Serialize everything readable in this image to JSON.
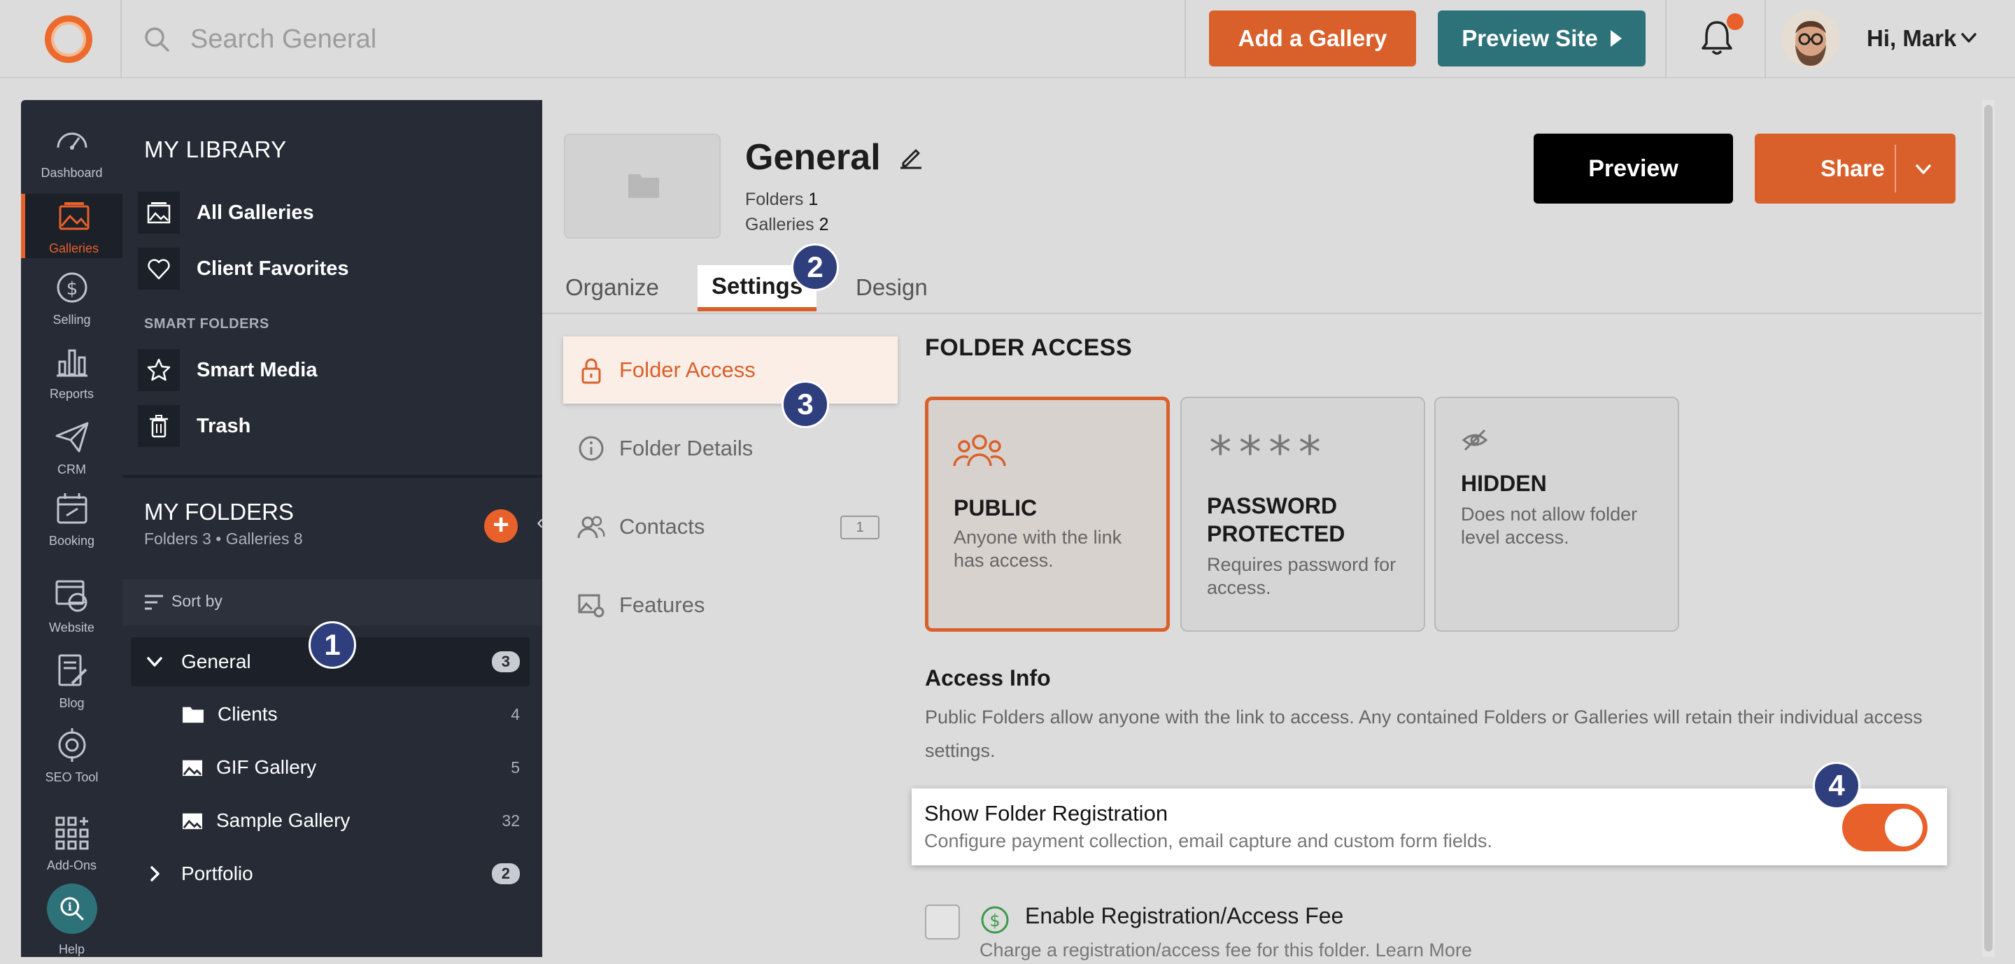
{
  "topbar": {
    "search_placeholder": "Search General",
    "add_gallery": "Add a Gallery",
    "preview_site": "Preview Site",
    "user_greeting": "Hi, Mark"
  },
  "rail": [
    {
      "label": "Dashboard",
      "icon": "dashboard-icon"
    },
    {
      "label": "Galleries",
      "icon": "galleries-icon",
      "active": true
    },
    {
      "label": "Selling",
      "icon": "dollar-icon"
    },
    {
      "label": "Reports",
      "icon": "bar-chart-icon"
    },
    {
      "label": "CRM",
      "icon": "paper-plane-icon"
    },
    {
      "label": "Booking",
      "icon": "calendar-icon"
    },
    {
      "label": "Website",
      "icon": "website-icon"
    },
    {
      "label": "Blog",
      "icon": "blog-icon"
    },
    {
      "label": "SEO Tool",
      "icon": "seo-icon"
    },
    {
      "label": "Add-Ons",
      "icon": "grid-icon"
    },
    {
      "label": "Help",
      "icon": "help-icon"
    }
  ],
  "library": {
    "heading": "MY LIBRARY",
    "items": [
      {
        "label": "All Galleries",
        "icon": "galleries-icon"
      },
      {
        "label": "Client Favorites",
        "icon": "heart-icon"
      }
    ],
    "smart_heading": "SMART FOLDERS",
    "smart_items": [
      {
        "label": "Smart Media",
        "icon": "star-icon"
      },
      {
        "label": "Trash",
        "icon": "trash-icon"
      }
    ],
    "folders_title": "MY FOLDERS",
    "folders_sub": "Folders 3 • Galleries 8",
    "sort_label": "Sort by",
    "tree": [
      {
        "label": "General",
        "count": "3",
        "expanded": true
      },
      {
        "label": "Clients",
        "count": "4"
      },
      {
        "label": "GIF Gallery",
        "count": "5"
      },
      {
        "label": "Sample Gallery",
        "count": "32"
      },
      {
        "label": "Portfolio",
        "count": "2"
      }
    ]
  },
  "header": {
    "title": "General",
    "folders_label": "Folders",
    "folders_value": "1",
    "galleries_label": "Galleries",
    "galleries_value": "2",
    "preview_label": "Preview",
    "share_label": "Share"
  },
  "tabs": [
    "Organize",
    "Settings",
    "Design"
  ],
  "subnav": [
    {
      "label": "Folder Access",
      "active": true
    },
    {
      "label": "Folder Details"
    },
    {
      "label": "Contacts",
      "count": "1"
    },
    {
      "label": "Features"
    }
  ],
  "access": {
    "section_title": "FOLDER ACCESS",
    "cards": [
      {
        "title": "PUBLIC",
        "desc": "Anyone with the link has access.",
        "selected": true
      },
      {
        "title": "PASSWORD PROTECTED",
        "desc": "Requires password for access.",
        "mask": "****"
      },
      {
        "title": "HIDDEN",
        "desc": "Does not allow folder level access."
      }
    ],
    "info_title": "Access Info",
    "info_text": "Public Folders allow anyone with the link to access. Any contained Folders or Galleries will retain their individual access settings.",
    "registration_title": "Show Folder Registration",
    "registration_sub": "Configure payment collection, email capture and custom form fields.",
    "registration_on": true,
    "fee_title": "Enable Registration/Access Fee",
    "fee_sub": "Charge a registration/access fee for this folder. Learn More"
  },
  "badges": [
    "1",
    "2",
    "3",
    "4"
  ],
  "colors": {
    "accent": "#d9602a",
    "teal": "#2e7279",
    "dark": "#262b35",
    "badge": "#2f3f7d"
  }
}
